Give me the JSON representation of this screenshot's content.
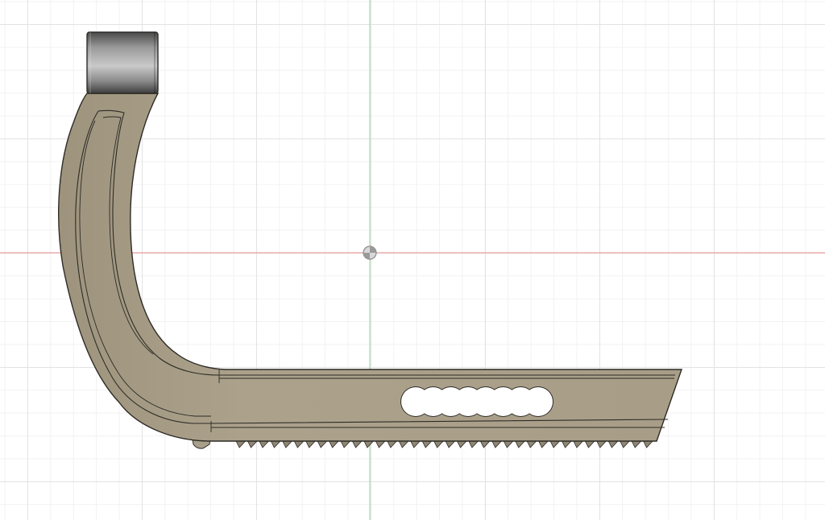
{
  "viewport": {
    "background": "#ffffff",
    "grid_major_color": "#e3e3e3",
    "grid_minor_color": "#f2f2f2"
  },
  "axes": {
    "x_axis_color": "#e88c8c",
    "y_axis_color": "#8fd68f"
  },
  "model": {
    "body_color": "#aaa08a",
    "edge_color": "#2d2b26",
    "bearing_color": "#7a7a7a",
    "slot_color": "#ffffff",
    "slot_count": 8,
    "tooth_count": 36
  },
  "origin": {
    "icon": "origin-icon"
  }
}
